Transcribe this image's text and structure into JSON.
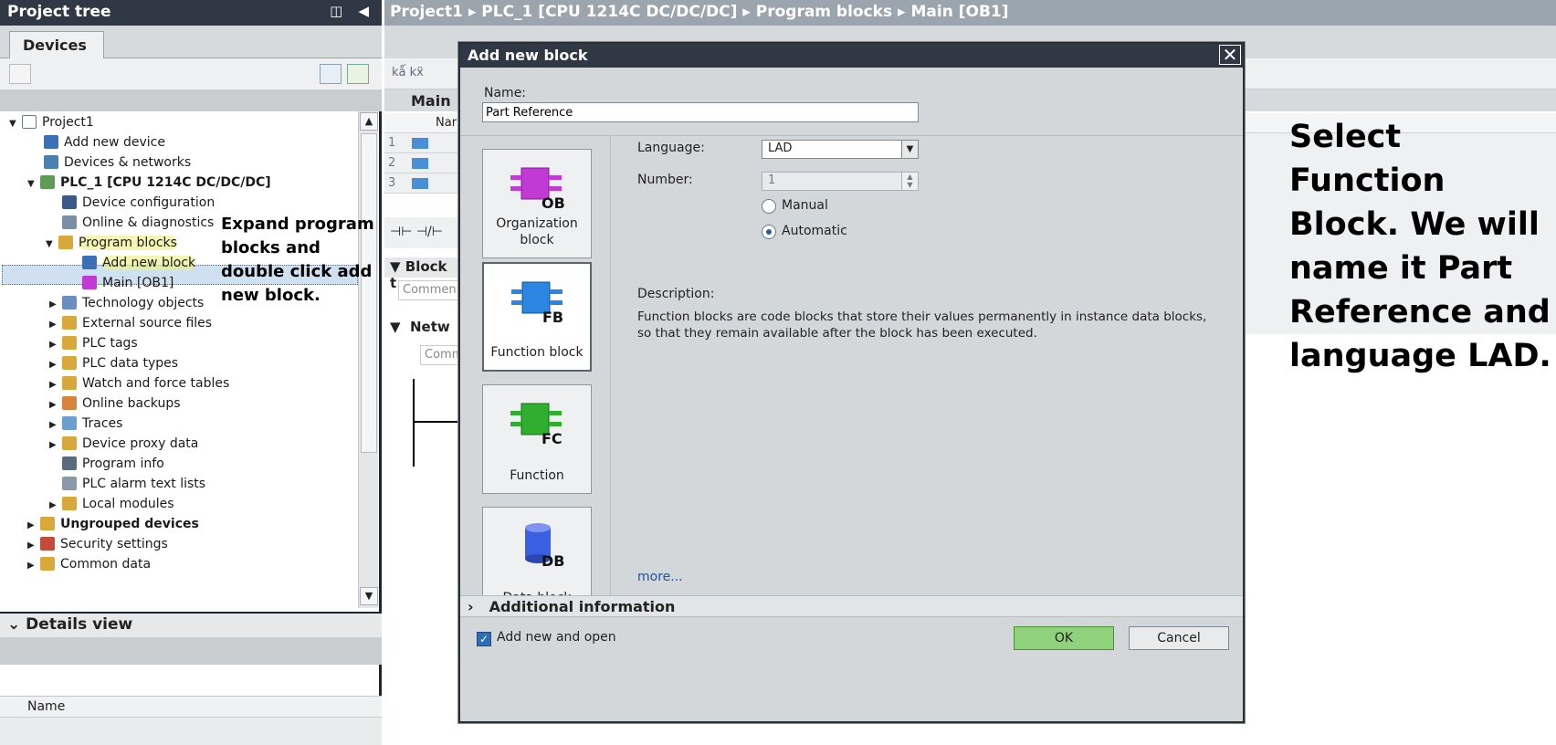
{
  "tree": {
    "header_title": "Project tree",
    "tab": "Devices",
    "items": [
      {
        "label": "Project1"
      },
      {
        "label": "Add new device"
      },
      {
        "label": "Devices & networks"
      },
      {
        "label": "PLC_1 [CPU 1214C DC/DC/DC]"
      },
      {
        "label": "Device configuration"
      },
      {
        "label": "Online & diagnostics"
      },
      {
        "label": "Program blocks"
      },
      {
        "label": "Add new block"
      },
      {
        "label": "Main [OB1]"
      },
      {
        "label": "Technology objects"
      },
      {
        "label": "External source files"
      },
      {
        "label": "PLC tags"
      },
      {
        "label": "PLC data types"
      },
      {
        "label": "Watch and force tables"
      },
      {
        "label": "Online backups"
      },
      {
        "label": "Traces"
      },
      {
        "label": "Device proxy data"
      },
      {
        "label": "Program info"
      },
      {
        "label": "PLC alarm text lists"
      },
      {
        "label": "Local modules"
      },
      {
        "label": "Ungrouped devices"
      },
      {
        "label": "Security settings"
      },
      {
        "label": "Common data"
      }
    ]
  },
  "details": {
    "title": "Details view",
    "col_name": "Name"
  },
  "editor": {
    "breadcrumb": "Project1  ▸  PLC_1 [CPU 1214C DC/DC/DC]  ▸  Program blocks  ▸  Main [OB1]",
    "main_label": "Main",
    "name_col": "Nar",
    "rows": [
      "1",
      "2",
      "3"
    ],
    "block_title": "Block t",
    "comment1": "Commen",
    "network": "Netw",
    "comment2": "Comm"
  },
  "callouts": {
    "left": "Expand program blocks and double click add new block.",
    "right": "Select Function Block. We will name it Part Reference and language LAD."
  },
  "dialog": {
    "title": "Add new block",
    "name_label": "Name:",
    "name_value": "Part Reference",
    "blocks": [
      {
        "abbr": "OB",
        "label": "Organization block",
        "color": "#c23ad6"
      },
      {
        "abbr": "FB",
        "label": "Function block",
        "color": "#2a86e0"
      },
      {
        "abbr": "FC",
        "label": "Function",
        "color": "#2fae2f"
      },
      {
        "abbr": "DB",
        "label": "Data block",
        "color": "#3a5fe0"
      }
    ],
    "language_label": "Language:",
    "language_value": "LAD",
    "number_label": "Number:",
    "number_value": "1",
    "radio_manual": "Manual",
    "radio_auto": "Automatic",
    "description_label": "Description:",
    "description_text": "Function blocks are code blocks that store their values permanently in instance data blocks, so that they remain available after the block has been executed.",
    "more_link": "more...",
    "additional_info": "Additional  information",
    "checkbox_label": "Add new and open",
    "ok": "OK",
    "cancel": "Cancel"
  }
}
